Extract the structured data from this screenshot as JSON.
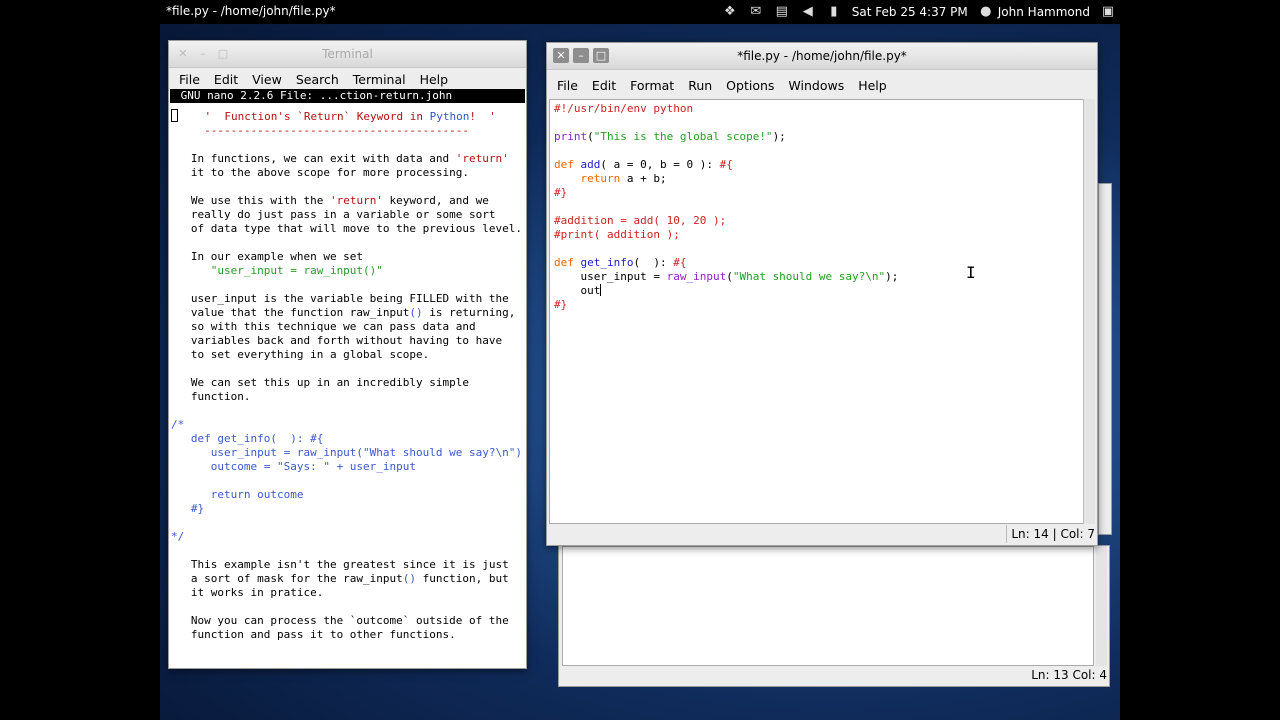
{
  "topbar": {
    "window_title": "*file.py - /home/john/file.py*",
    "datetime": "Sat Feb 25  4:37 PM",
    "user_name": "John Hammond",
    "icons": [
      "dropbox-icon",
      "mail-icon",
      "clipboard-icon",
      "volume-icon",
      "network-icon",
      "user-icon",
      "display-icon"
    ]
  },
  "terminal": {
    "title": "Terminal",
    "menu": [
      "File",
      "Edit",
      "View",
      "Search",
      "Terminal",
      "Help"
    ],
    "nano_header": " GNU nano 2.2.6 File: ...ction-return.john",
    "heading_pre": "    '  Function's `Return` Keyword in ",
    "heading_word": "Python",
    "heading_post": "!  '",
    "dash_line": "     ----------------------------------------",
    "p1a": "   In functions, we can exit with data and ",
    "p1b": "'return'",
    "p1c": "   it to the above scope for more processing.",
    "p2a": "   We use this with the ",
    "p2b": "'return'",
    "p2c": " keyword, and we",
    "p2d": "   really do just pass in a variable or some sort",
    "p2e": "   of data type that will move to the previous level.",
    "p3a": "   In our example when we set",
    "p3b": "      \"user_input = raw_input()\"",
    "p4a": "   user_input is the variable being FILLED with the",
    "p4b": "   value that the function raw_input",
    "p4c": "()",
    "p4d": " is returning,",
    "p4e": "   so with this technique we can pass data and",
    "p4f": "   variables back and forth without having to have",
    "p4g": "   to set everything in a global scope.",
    "p5a": "   We can set this up in an incredibly simple",
    "p5b": "   function.",
    "code_open": "/*",
    "code1": "   def get_info(  ): #{",
    "code2": "      user_input = raw_input(\"What should we say?\\n\")",
    "code3": "      outcome = \"Says: \" + user_input",
    "code4": "      return outcome",
    "code5": "   #}",
    "code_close": "*/",
    "p6a": "   This example isn't the greatest since it is just",
    "p6b": "   a sort of mask for the raw_input",
    "p6c": "()",
    "p6d": " function, but",
    "p6e": "   it works in pratice.",
    "p7a": "   Now you can process the `outcome` outside of the",
    "p7b": "   function and pass it to other functions."
  },
  "editor": {
    "title": "*file.py - /home/john/file.py*",
    "menu": [
      "File",
      "Edit",
      "Format",
      "Run",
      "Options",
      "Windows",
      "Help"
    ],
    "l1": "#!/usr/bin/env python",
    "l3a": "print",
    "l3b": "(",
    "l3c": "\"This is the global scope!\"",
    "l3d": ");",
    "l5a": "def",
    "l5b": " ",
    "l5c": "add",
    "l5d": "( a = 0, b = 0 ): ",
    "l5e": "#{",
    "l6a": "    ",
    "l6b": "return",
    "l6c": " a + b;",
    "l7": "#}",
    "l9": "#addition = add( 10, 20 );",
    "l10": "#print( addition );",
    "l12a": "def",
    "l12b": " ",
    "l12c": "get_info",
    "l12d": "(  ): ",
    "l12e": "#{",
    "l13a": "    user_input = ",
    "l13b": "raw_input",
    "l13c": "(",
    "l13d": "\"What should we say?\\n\"",
    "l13e": ");",
    "l14": "    out",
    "l15": "#}",
    "status_ln": "Ln: 14",
    "status_col": "Col: 7"
  },
  "editor_back": {
    "status_ln": "Ln: 13",
    "status_col": "Col: 4"
  }
}
